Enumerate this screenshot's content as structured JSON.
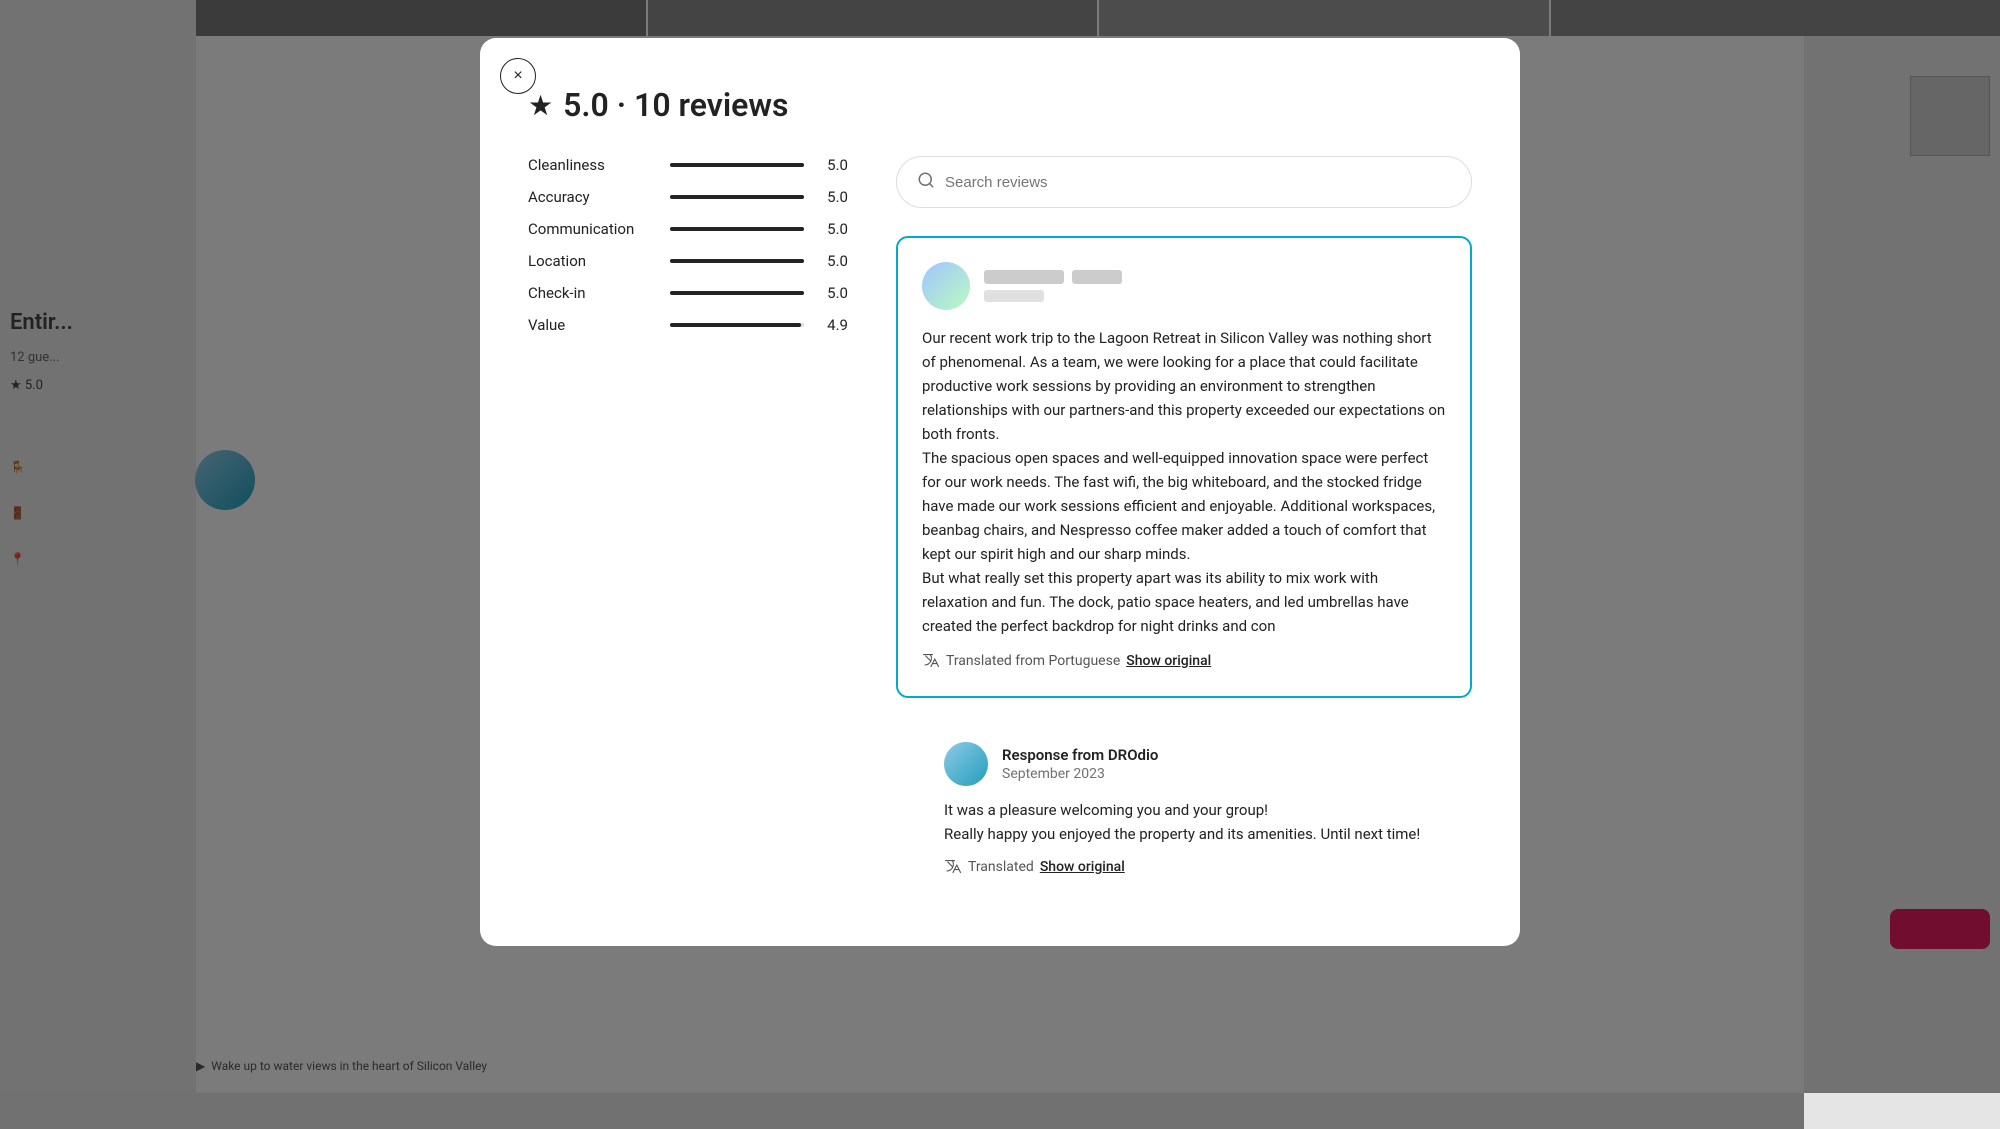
{
  "modal": {
    "close_button_label": "×",
    "star_icon": "★",
    "title": "5.0 · 10 reviews",
    "search": {
      "placeholder": "Search reviews",
      "icon": "🔍"
    },
    "ratings": [
      {
        "label": "Cleanliness",
        "value": "5.0",
        "fill_pct": 100
      },
      {
        "label": "Accuracy",
        "value": "5.0",
        "fill_pct": 100
      },
      {
        "label": "Communication",
        "value": "5.0",
        "fill_pct": 100
      },
      {
        "label": "Location",
        "value": "5.0",
        "fill_pct": 100
      },
      {
        "label": "Check-in",
        "value": "5.0",
        "fill_pct": 100
      },
      {
        "label": "Value",
        "value": "4.9",
        "fill_pct": 98
      }
    ],
    "review": {
      "text": "Our recent work trip to the Lagoon Retreat in Silicon Valley was nothing short of phenomenal. As a team, we were looking for a place that could facilitate productive work sessions by providing an environment to strengthen relationships with our partners-and this property exceeded our expectations on both fronts.\nThe spacious open spaces and well-equipped innovation space were perfect for our work needs. The fast wifi, the big whiteboard, and the stocked fridge have made our work sessions efficient and enjoyable. Additional workspaces, beanbag chairs, and Nespresso coffee maker added a touch of comfort that kept our spirit high and our sharp minds.\nBut what really set this property apart was its ability to mix work with relaxation and fun. The dock, patio space heaters, and led umbrellas have created the perfect backdrop for night drinks and con",
      "translation_label": "Translated from Portuguese",
      "show_original_label": "Show original",
      "host_response": {
        "name": "Response from DROdio",
        "date": "September 2023",
        "text": "It was a pleasure welcoming you and your group!\nReally happy you enjoyed the property and its amenities. Until next time!",
        "translation_label": "Translated",
        "show_original_label": "Show original"
      }
    }
  },
  "background": {
    "listing_title": "Entir...",
    "listing_sub": "12 gue...",
    "rating": "5.0",
    "footer_text": "Wake up to water views in the heart of Silicon Valley",
    "icons": [
      "🪑",
      "🚪",
      "📍"
    ]
  }
}
